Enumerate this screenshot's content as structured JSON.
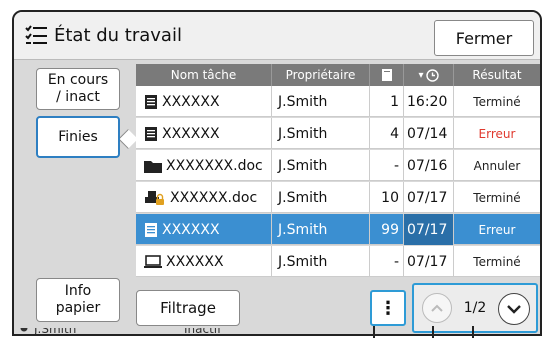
{
  "header": {
    "title": "État du travail",
    "close_label": "Fermer"
  },
  "sidebar": {
    "in_progress_label": "En cours\n/ inact",
    "finished_label": "Finies",
    "paper_info_label": "Info\npapier"
  },
  "table": {
    "columns": {
      "name": "Nom tâche",
      "owner": "Propriétaire",
      "copies": "",
      "time": "▾",
      "result": "Résultat"
    },
    "rows": [
      {
        "icon": "document-icon",
        "name": "XXXXXX",
        "owner": "J.Smith",
        "copies": "1",
        "time": "16:20",
        "result": "Terminé",
        "result_color": "#222222"
      },
      {
        "icon": "document-icon",
        "name": "XXXXXX",
        "owner": "J.Smith",
        "copies": "4",
        "time": "07/14",
        "result": "Erreur",
        "result_color": "#e03a2f"
      },
      {
        "icon": "folder-icon",
        "name": "XXXXXXX.doc",
        "owner": "J.Smith",
        "copies": "-",
        "time": "07/16",
        "result": "Annuler",
        "result_color": "#222222"
      },
      {
        "icon": "printer-lock-icon",
        "name": "XXXXXX.doc",
        "owner": "J.Smith",
        "copies": "10",
        "time": "07/17",
        "result": "Terminé",
        "result_color": "#222222"
      },
      {
        "icon": "document-icon",
        "name": "XXXXXX",
        "owner": "J.Smith",
        "copies": "99",
        "time": "07/17",
        "result": "Erreur",
        "result_color": "#ffffff"
      },
      {
        "icon": "monitor-icon",
        "name": "XXXXXX",
        "owner": "J.Smith",
        "copies": "-",
        "time": "07/17",
        "result": "Terminé",
        "result_color": "#222222"
      }
    ]
  },
  "footer": {
    "filter_label": "Filtrage",
    "more_label": "⋮",
    "page_indicator": "1/2"
  },
  "status_bar": {
    "user": "J.Smith",
    "state": "Inactif"
  },
  "colors": {
    "accent": "#2e9bd6",
    "selected_row": "#3b8fd1",
    "header": "#7a7a7a",
    "error": "#e03a2f"
  }
}
